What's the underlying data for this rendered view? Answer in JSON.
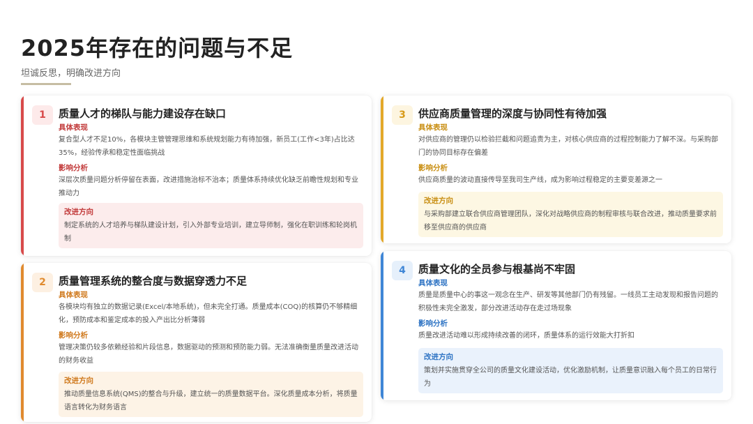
{
  "header": {
    "title": "2025年存在的问题与不足",
    "subtitle": "坦诚反思，明确改进方向"
  },
  "colors": {
    "card1_accent": "#d84a4a",
    "card2_accent": "#e08a2e",
    "card3_accent": "#e3a82a",
    "card4_accent": "#3f86d6"
  },
  "cards": [
    {
      "number": "1",
      "title": "质量人才的梯队与能力建设存在缺口",
      "symptom_label": "具体表现",
      "symptom_text": "复合型人才不足10%，各模块主管管理思维和系统规划能力有待加强，新员工(工作<3年)占比达35%，经验传承和稳定性面临挑战",
      "impact_label": "影响分析",
      "impact_text": "深层次质量问题分析停留在表面，改进措施治标不治本；质量体系持续优化缺乏前瞻性规划和专业推动力",
      "improve_label": "改进方向",
      "improve_text": "制定系统的人才培养与梯队建设计划，引入外部专业培训，建立导师制，强化在职训练和轮岗机制"
    },
    {
      "number": "2",
      "title": "质量管理系统的整合度与数据穿透力不足",
      "symptom_label": "具体表现",
      "symptom_text": "各模块均有独立的数据记录(Excel/本地系统)，但未完全打通。质量成本(COQ)的核算仍不够精细化，预防成本和鉴定成本的投入产出比分析薄弱",
      "impact_label": "影响分析",
      "impact_text": "管理决策仍较多依赖经验和片段信息，数据驱动的预测和预防能力弱。无法准确衡量质量改进活动的财务收益",
      "improve_label": "改进方向",
      "improve_text": "推动质量信息系统(QMS)的整合与升级，建立统一的质量数据平台。深化质量成本分析，将质量语言转化为财务语言"
    },
    {
      "number": "3",
      "title": "供应商质量管理的深度与协同性有待加强",
      "symptom_label": "具体表现",
      "symptom_text": "对供应商的管理仍以检验拦截和问题追责为主，对核心供应商的过程控制能力了解不深。与采购部门的协同目标存在偏差",
      "impact_label": "影响分析",
      "impact_text": "供应商质量的波动直接传导至我司生产线，成为影响过程稳定的主要变差源之一",
      "improve_label": "改进方向",
      "improve_text": "与采购部建立联合供应商管理团队，深化对战略供应商的制程审核与联合改进，推动质量要求前移至供应商的供应商"
    },
    {
      "number": "4",
      "title": "质量文化的全员参与根基尚不牢固",
      "symptom_label": "具体表现",
      "symptom_text": "质量是质量中心的事这一观念在生产、研发等其他部门仍有残留。一线员工主动发现和报告问题的积极性未完全激发，部分改进活动存在走过场现象",
      "impact_label": "影响分析",
      "impact_text": "质量改进活动难以形成持续改善的闭环，质量体系的运行效能大打折扣",
      "improve_label": "改进方向",
      "improve_text": "策划并实施贯穿全公司的质量文化建设活动，优化激励机制，让质量意识融入每个员工的日常行为"
    }
  ]
}
